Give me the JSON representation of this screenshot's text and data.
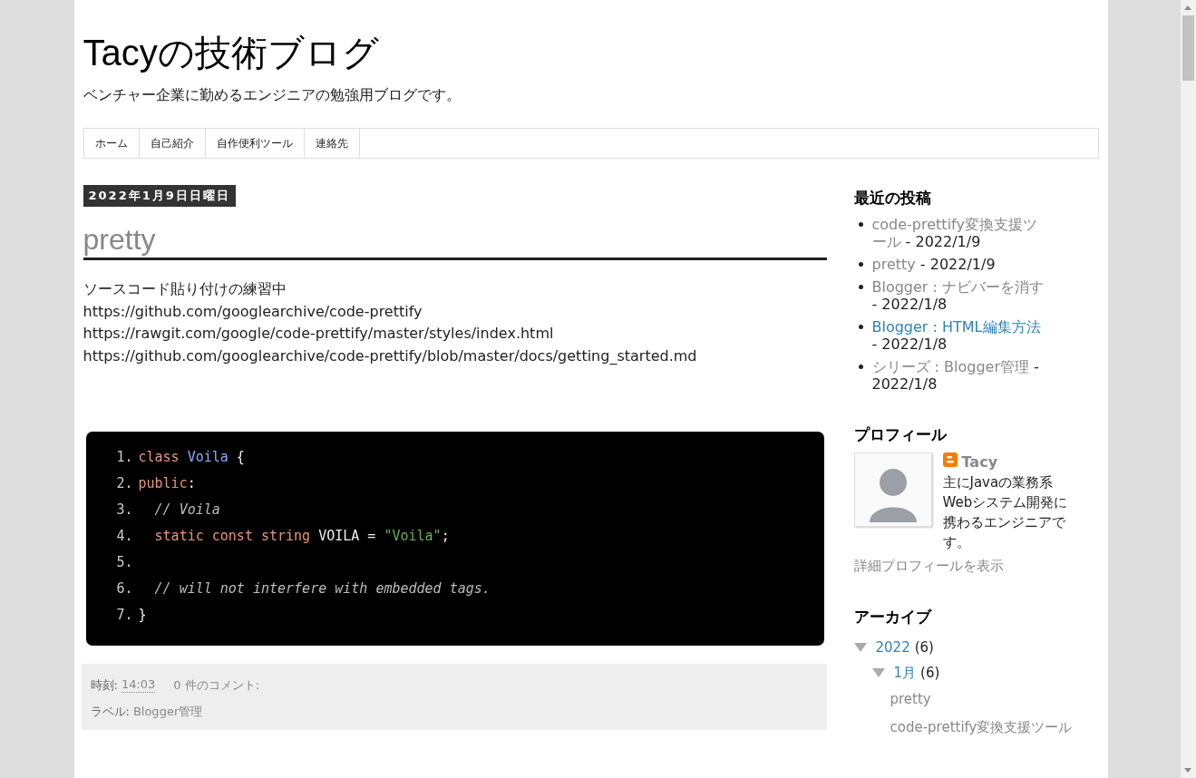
{
  "blog": {
    "title": "Tacyの技術ブログ",
    "description": "ベンチャー企業に勤めるエンジニアの勉強用ブログです。"
  },
  "nav": {
    "items": [
      {
        "label": "ホーム"
      },
      {
        "label": "自己紹介"
      },
      {
        "label": "自作便利ツール"
      },
      {
        "label": "連絡先"
      }
    ]
  },
  "post": {
    "date": "2022年1月9日日曜日",
    "title": "pretty",
    "body": [
      "ソースコード貼り付けの練習中",
      "https://github.com/googlearchive/code-prettify",
      "https://rawgit.com/google/code-prettify/master/styles/index.html",
      "https://github.com/googlearchive/code-prettify/blob/master/docs/getting_started.md"
    ],
    "code": [
      {
        "number": "1.",
        "tokens": [
          {
            "kind": "keyword",
            "text": "class"
          },
          {
            "kind": "type",
            "text": " Voila"
          },
          {
            "kind": "plain",
            "text": " {"
          }
        ]
      },
      {
        "number": "2.",
        "tokens": [
          {
            "kind": "keyword",
            "text": "public"
          },
          {
            "kind": "plain",
            "text": ":"
          }
        ]
      },
      {
        "number": "3.",
        "tokens": [
          {
            "kind": "comment",
            "text": "  // Voila"
          }
        ]
      },
      {
        "number": "4.",
        "tokens": [
          {
            "kind": "keyword",
            "text": "  static const string"
          },
          {
            "kind": "plain",
            "text": " VOILA = "
          },
          {
            "kind": "string",
            "text": "\"Voila\""
          },
          {
            "kind": "plain",
            "text": ";"
          }
        ]
      },
      {
        "number": "5."
      },
      {
        "number": "6.",
        "tokens": [
          {
            "kind": "comment",
            "text": "  // will not interfere with embedded tags."
          }
        ]
      },
      {
        "number": "7.",
        "tokens": [
          {
            "kind": "plain",
            "text": "}"
          }
        ]
      }
    ],
    "footer": {
      "time_label": "時刻:",
      "time": "14:03",
      "comments": "0 件のコメント:",
      "labels_label": "ラベル:",
      "label": "Blogger管理"
    }
  },
  "sidebar": {
    "recent": {
      "title": "最近の投稿",
      "items": [
        {
          "title": "code-prettify変換支援ツール",
          "date": " - 2022/1/9",
          "hovered": false
        },
        {
          "title": "pretty",
          "date": " - 2022/1/9",
          "hovered": false
        },
        {
          "title": "Blogger : ナビバーを消す",
          "date": " - 2022/1/8",
          "hovered": false
        },
        {
          "title": "Blogger : HTML編集方法",
          "date": " - 2022/1/8",
          "hovered": true
        },
        {
          "title": "シリーズ : Blogger管理",
          "date": " - 2022/1/8",
          "hovered": false
        }
      ]
    },
    "profile": {
      "title": "プロフィール",
      "name": "Tacy",
      "about": "主にJavaの業務系Webシステム開発に携わるエンジニアです。",
      "link": "詳細プロフィールを表示"
    },
    "archive": {
      "title": "アーカイブ",
      "items": [
        {
          "label": "2022",
          "count": "(6)",
          "expanded": true,
          "children": [
            {
              "label": "1月",
              "count": "(6)",
              "expanded": true,
              "children": [
                {
                  "label": "pretty"
                },
                {
                  "label": "code-prettify変換支援ツール"
                }
              ]
            }
          ]
        }
      ]
    }
  }
}
